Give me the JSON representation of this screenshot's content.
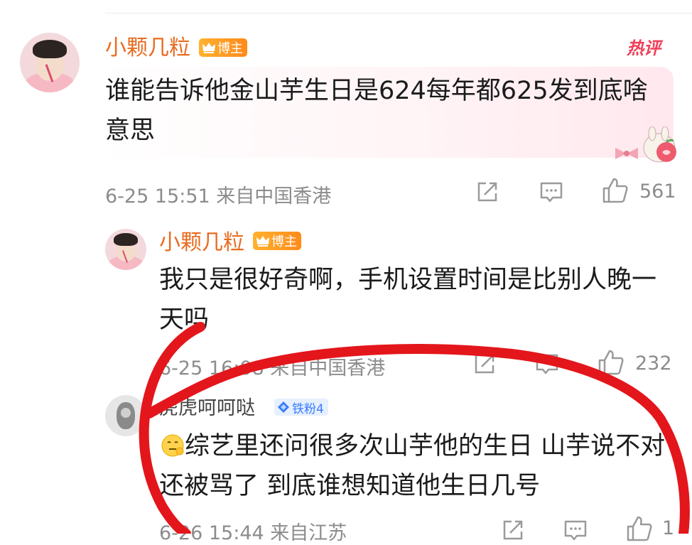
{
  "comment1": {
    "username": "小颗几粒",
    "badge": "博主",
    "hot_label": "热评",
    "text": "谁能告诉他金山芋生日是624每年都625发到底啥意思",
    "time": "6-25 15:51",
    "location": "来自中国香港",
    "likes": "561"
  },
  "reply1": {
    "username": "小颗几粒",
    "badge": "博主",
    "text": "我只是很好奇啊，手机设置时间是比别人晚一天吗",
    "time": "6-25 16:08",
    "location": "来自中国香港",
    "likes": "232"
  },
  "reply2": {
    "username": "虎虎呵呵哒",
    "badge": "铁粉4",
    "text": "综艺里还问很多次山芋他的生日 山芋说不对还被骂了 到底谁想知道他生日几号",
    "time": "6-26 15:44",
    "location": "来自江苏",
    "likes": "1"
  },
  "colors": {
    "username": "#e86b1f",
    "hot": "#f03f59",
    "meta": "#8c8c8c",
    "annotation": "#e3161b"
  },
  "icons": [
    "share-icon",
    "comment-icon",
    "like-icon",
    "crown-icon",
    "diamond-icon",
    "emoji-icon",
    "bunny-sticker-icon"
  ]
}
